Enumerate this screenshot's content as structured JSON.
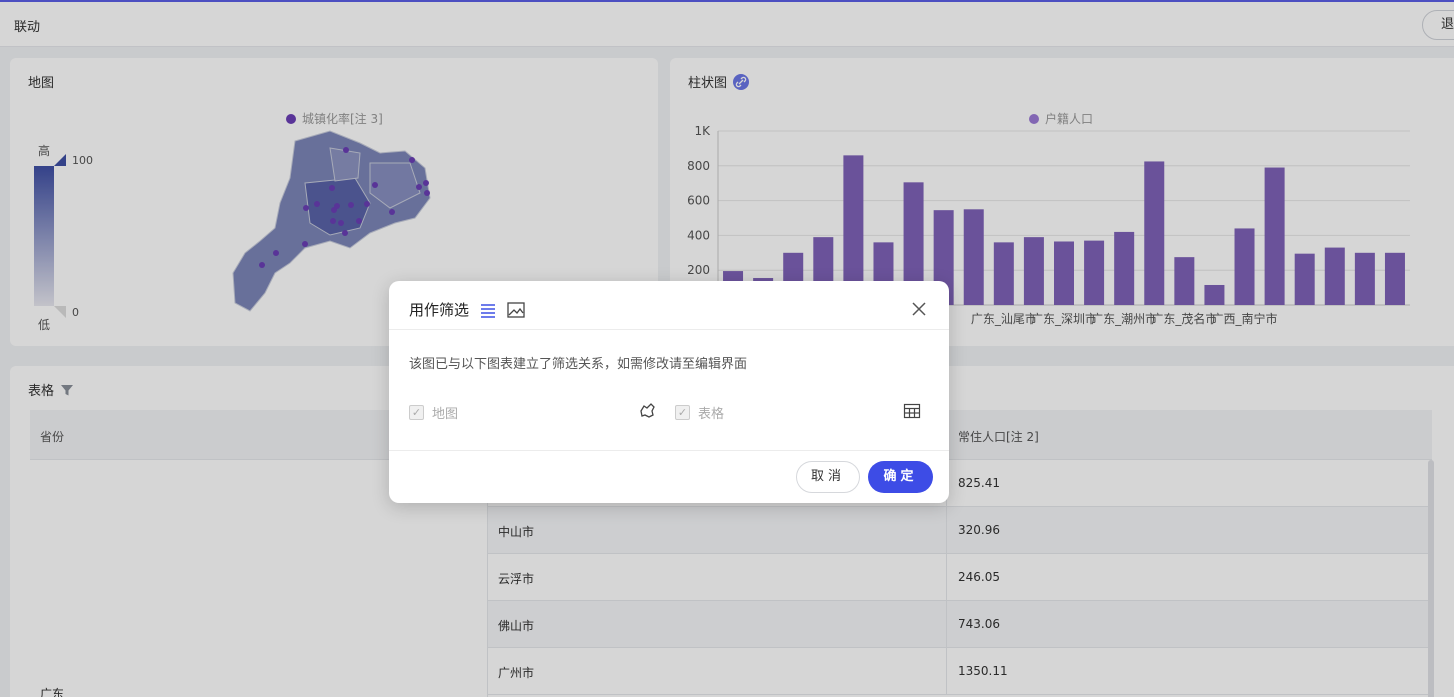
{
  "topbar": {
    "title": "联动",
    "exit_label": "退"
  },
  "map_card": {
    "title": "地图",
    "legend": "城镇化率[注 3]",
    "visualmap": {
      "high_label": "高",
      "low_label": "低",
      "max": "100",
      "min": "0"
    }
  },
  "bar_card": {
    "title": "柱状图",
    "link_icon": "link-icon"
  },
  "chart_data": {
    "type": "bar",
    "title": "",
    "series": [
      {
        "name": "户籍人口",
        "values": [
          195,
          155,
          300,
          390,
          860,
          360,
          705,
          545,
          550,
          360,
          390,
          365,
          370,
          420,
          825,
          275,
          115,
          440,
          790,
          295,
          330,
          300,
          300
        ]
      }
    ],
    "categories": [
      "",
      "",
      "",
      "",
      "",
      "",
      "",
      "",
      "",
      "广东_汕尾市",
      "",
      "广东_深圳市",
      "",
      "广东_潮州市",
      "",
      "广东_茂名市",
      "",
      "广西_南宁市",
      "",
      "",
      "",
      "",
      ""
    ],
    "x_tick_labels": [
      "广东_汕尾市",
      "广东_深圳市",
      "广东_潮州市",
      "广东_茂名市",
      "广西_南宁市"
    ],
    "y_ticks": [
      "200",
      "400",
      "600",
      "800",
      "1K"
    ],
    "ylim": [
      0,
      1000
    ],
    "color": "#7f62b8",
    "grid": true,
    "legend_position": "top-center"
  },
  "table_card": {
    "title": "表格",
    "filter_icon": "filter-icon",
    "columns": [
      "省份",
      "常住人口[注 2]"
    ],
    "province": "广东",
    "rows": [
      {
        "city": "",
        "value": "825.41"
      },
      {
        "city": "中山市",
        "value": "320.96"
      },
      {
        "city": "云浮市",
        "value": "246.05"
      },
      {
        "city": "佛山市",
        "value": "743.06"
      },
      {
        "city": "广州市",
        "value": "1350.11"
      }
    ]
  },
  "dialog": {
    "title": "用作筛选",
    "description": "该图已与以下图表建立了筛选关系，如需修改请至编辑界面",
    "options": [
      {
        "label": "地图",
        "icon": "map-icon"
      },
      {
        "label": "表格",
        "icon": "table-icon"
      }
    ],
    "cancel_label": "取消",
    "ok_label": "确定"
  }
}
